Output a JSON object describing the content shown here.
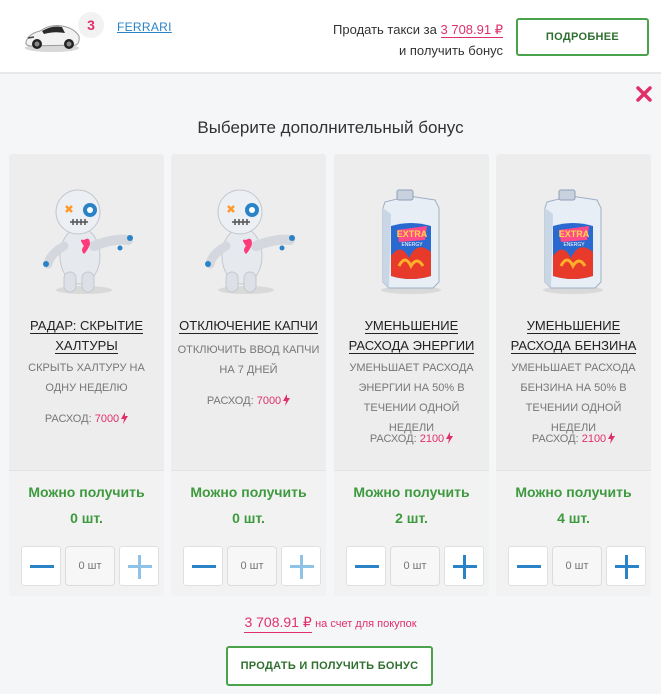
{
  "header": {
    "level": "3",
    "car_name": "FERRARI",
    "sell_prefix": "Продать такси за",
    "sell_price": "3 708.91 ₽",
    "sell_suffix": "и получить бонус",
    "more_button": "ПОДРОБНЕЕ"
  },
  "title": "Выберите дополнительный бонус",
  "cost_label": "РАСХОД:",
  "can_get_label": "Можно получить",
  "bonuses": [
    {
      "name": "РАДАР: СКРЫТИЕ ХАЛТУРЫ",
      "desc": "СКРЫТЬ ХАЛТУРУ НА ОДНУ НЕДЕЛЮ",
      "cost": "7000",
      "qty": "0 шт.",
      "input_placeholder": "0 шт",
      "image": "voodoo-doll-icon"
    },
    {
      "name": "ОТКЛЮЧЕНИЕ КАПЧИ",
      "desc": "ОТКЛЮЧИТЬ ВВОД КАПЧИ НА 7 ДНЕЙ",
      "cost": "7000",
      "qty": "0 шт.",
      "input_placeholder": "0 шт",
      "image": "voodoo-doll-icon"
    },
    {
      "name": "УМЕНЬШЕНИЕ РАСХОДА ЭНЕРГИИ",
      "desc": "УМЕНЬШАЕТ РАСХОДА ЭНЕРГИИ НА 50% В ТЕЧЕНИИ ОДНОЙ НЕДЕЛИ",
      "cost": "2100",
      "qty": "2 шт.",
      "input_placeholder": "0 шт",
      "image": "extra-energy-canister-icon"
    },
    {
      "name": "УМЕНЬШЕНИЕ РАСХОДА БЕНЗИНА",
      "desc": "УМЕНЬШАЕТ РАСХОДА БЕНЗИНА НА 50% В ТЕЧЕНИИ ОДНОЙ НЕДЕЛИ",
      "cost": "2100",
      "qty": "4 шт.",
      "input_placeholder": "0 шт",
      "image": "extra-energy-canister-icon"
    }
  ],
  "footer": {
    "total": "3 708.91 ₽",
    "total_suffix": "на счет для покупок",
    "sell_button": "ПРОДАТЬ И ПОЛУЧИТЬ БОНУС"
  },
  "colors": {
    "accent_pink": "#e0306a",
    "accent_green": "#3e9a3e",
    "link_blue": "#2a83c6"
  }
}
